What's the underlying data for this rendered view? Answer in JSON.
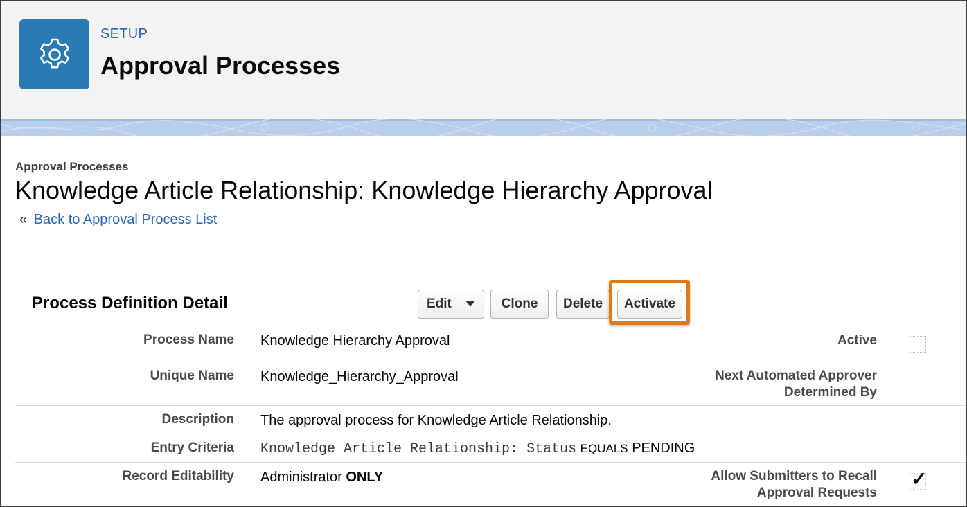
{
  "header": {
    "eyebrow": "SETUP",
    "title": "Approval Processes",
    "icon": "gear-icon"
  },
  "breadcrumb": "Approval Processes",
  "page_title": "Knowledge Article Relationship: Knowledge Hierarchy Approval",
  "back_link": {
    "arrows": "«",
    "label": "Back to Approval Process List"
  },
  "section_title": "Process Definition Detail",
  "buttons": {
    "edit": "Edit",
    "clone": "Clone",
    "delete": "Delete",
    "activate": "Activate"
  },
  "highlight_color": "#e07a10",
  "fields": {
    "process_name": {
      "label": "Process Name",
      "value": "Knowledge Hierarchy Approval"
    },
    "active": {
      "label": "Active",
      "checked": false
    },
    "unique_name": {
      "label": "Unique Name",
      "value": "Knowledge_Hierarchy_Approval"
    },
    "next_approver": {
      "label_line1": "Next Automated Approver",
      "label_line2": "Determined By"
    },
    "description": {
      "label": "Description",
      "value": "The approval process for Knowledge Article Relationship."
    },
    "entry_criteria": {
      "label": "Entry Criteria",
      "field": "Knowledge Article Relationship: Status",
      "operator": "EQUALS",
      "value": "PENDING"
    },
    "record_editability": {
      "label": "Record Editability",
      "value_prefix": "Administrator",
      "value_strong": "ONLY"
    },
    "allow_recall": {
      "label_line1": "Allow Submitters to Recall",
      "label_line2": "Approval Requests",
      "checked": true,
      "check_glyph": "✓"
    }
  }
}
